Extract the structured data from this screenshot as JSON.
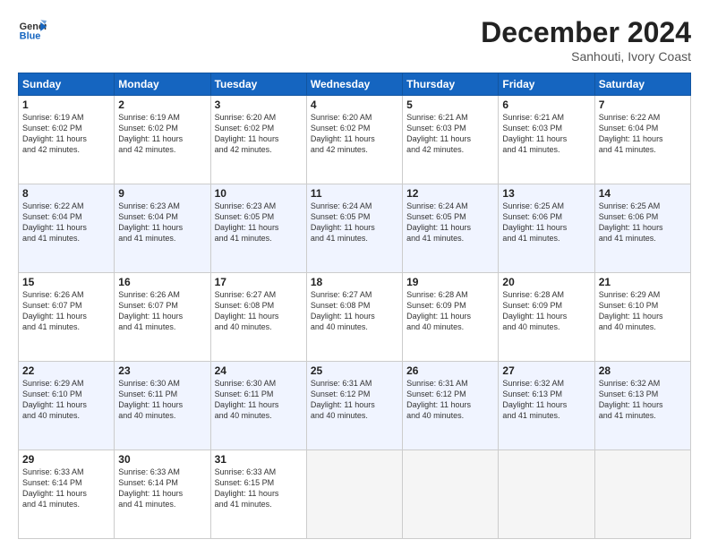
{
  "header": {
    "logo_line1": "General",
    "logo_line2": "Blue",
    "title": "December 2024",
    "subtitle": "Sanhouti, Ivory Coast"
  },
  "days_of_week": [
    "Sunday",
    "Monday",
    "Tuesday",
    "Wednesday",
    "Thursday",
    "Friday",
    "Saturday"
  ],
  "weeks": [
    [
      {
        "num": "1",
        "sunrise": "6:19 AM",
        "sunset": "6:02 PM",
        "daylight": "11 hours and 42 minutes."
      },
      {
        "num": "2",
        "sunrise": "6:19 AM",
        "sunset": "6:02 PM",
        "daylight": "11 hours and 42 minutes."
      },
      {
        "num": "3",
        "sunrise": "6:20 AM",
        "sunset": "6:02 PM",
        "daylight": "11 hours and 42 minutes."
      },
      {
        "num": "4",
        "sunrise": "6:20 AM",
        "sunset": "6:02 PM",
        "daylight": "11 hours and 42 minutes."
      },
      {
        "num": "5",
        "sunrise": "6:21 AM",
        "sunset": "6:03 PM",
        "daylight": "11 hours and 42 minutes."
      },
      {
        "num": "6",
        "sunrise": "6:21 AM",
        "sunset": "6:03 PM",
        "daylight": "11 hours and 41 minutes."
      },
      {
        "num": "7",
        "sunrise": "6:22 AM",
        "sunset": "6:04 PM",
        "daylight": "11 hours and 41 minutes."
      }
    ],
    [
      {
        "num": "8",
        "sunrise": "6:22 AM",
        "sunset": "6:04 PM",
        "daylight": "11 hours and 41 minutes."
      },
      {
        "num": "9",
        "sunrise": "6:23 AM",
        "sunset": "6:04 PM",
        "daylight": "11 hours and 41 minutes."
      },
      {
        "num": "10",
        "sunrise": "6:23 AM",
        "sunset": "6:05 PM",
        "daylight": "11 hours and 41 minutes."
      },
      {
        "num": "11",
        "sunrise": "6:24 AM",
        "sunset": "6:05 PM",
        "daylight": "11 hours and 41 minutes."
      },
      {
        "num": "12",
        "sunrise": "6:24 AM",
        "sunset": "6:05 PM",
        "daylight": "11 hours and 41 minutes."
      },
      {
        "num": "13",
        "sunrise": "6:25 AM",
        "sunset": "6:06 PM",
        "daylight": "11 hours and 41 minutes."
      },
      {
        "num": "14",
        "sunrise": "6:25 AM",
        "sunset": "6:06 PM",
        "daylight": "11 hours and 41 minutes."
      }
    ],
    [
      {
        "num": "15",
        "sunrise": "6:26 AM",
        "sunset": "6:07 PM",
        "daylight": "11 hours and 41 minutes."
      },
      {
        "num": "16",
        "sunrise": "6:26 AM",
        "sunset": "6:07 PM",
        "daylight": "11 hours and 41 minutes."
      },
      {
        "num": "17",
        "sunrise": "6:27 AM",
        "sunset": "6:08 PM",
        "daylight": "11 hours and 40 minutes."
      },
      {
        "num": "18",
        "sunrise": "6:27 AM",
        "sunset": "6:08 PM",
        "daylight": "11 hours and 40 minutes."
      },
      {
        "num": "19",
        "sunrise": "6:28 AM",
        "sunset": "6:09 PM",
        "daylight": "11 hours and 40 minutes."
      },
      {
        "num": "20",
        "sunrise": "6:28 AM",
        "sunset": "6:09 PM",
        "daylight": "11 hours and 40 minutes."
      },
      {
        "num": "21",
        "sunrise": "6:29 AM",
        "sunset": "6:10 PM",
        "daylight": "11 hours and 40 minutes."
      }
    ],
    [
      {
        "num": "22",
        "sunrise": "6:29 AM",
        "sunset": "6:10 PM",
        "daylight": "11 hours and 40 minutes."
      },
      {
        "num": "23",
        "sunrise": "6:30 AM",
        "sunset": "6:11 PM",
        "daylight": "11 hours and 40 minutes."
      },
      {
        "num": "24",
        "sunrise": "6:30 AM",
        "sunset": "6:11 PM",
        "daylight": "11 hours and 40 minutes."
      },
      {
        "num": "25",
        "sunrise": "6:31 AM",
        "sunset": "6:12 PM",
        "daylight": "11 hours and 40 minutes."
      },
      {
        "num": "26",
        "sunrise": "6:31 AM",
        "sunset": "6:12 PM",
        "daylight": "11 hours and 40 minutes."
      },
      {
        "num": "27",
        "sunrise": "6:32 AM",
        "sunset": "6:13 PM",
        "daylight": "11 hours and 41 minutes."
      },
      {
        "num": "28",
        "sunrise": "6:32 AM",
        "sunset": "6:13 PM",
        "daylight": "11 hours and 41 minutes."
      }
    ],
    [
      {
        "num": "29",
        "sunrise": "6:33 AM",
        "sunset": "6:14 PM",
        "daylight": "11 hours and 41 minutes."
      },
      {
        "num": "30",
        "sunrise": "6:33 AM",
        "sunset": "6:14 PM",
        "daylight": "11 hours and 41 minutes."
      },
      {
        "num": "31",
        "sunrise": "6:33 AM",
        "sunset": "6:15 PM",
        "daylight": "11 hours and 41 minutes."
      },
      null,
      null,
      null,
      null
    ]
  ]
}
